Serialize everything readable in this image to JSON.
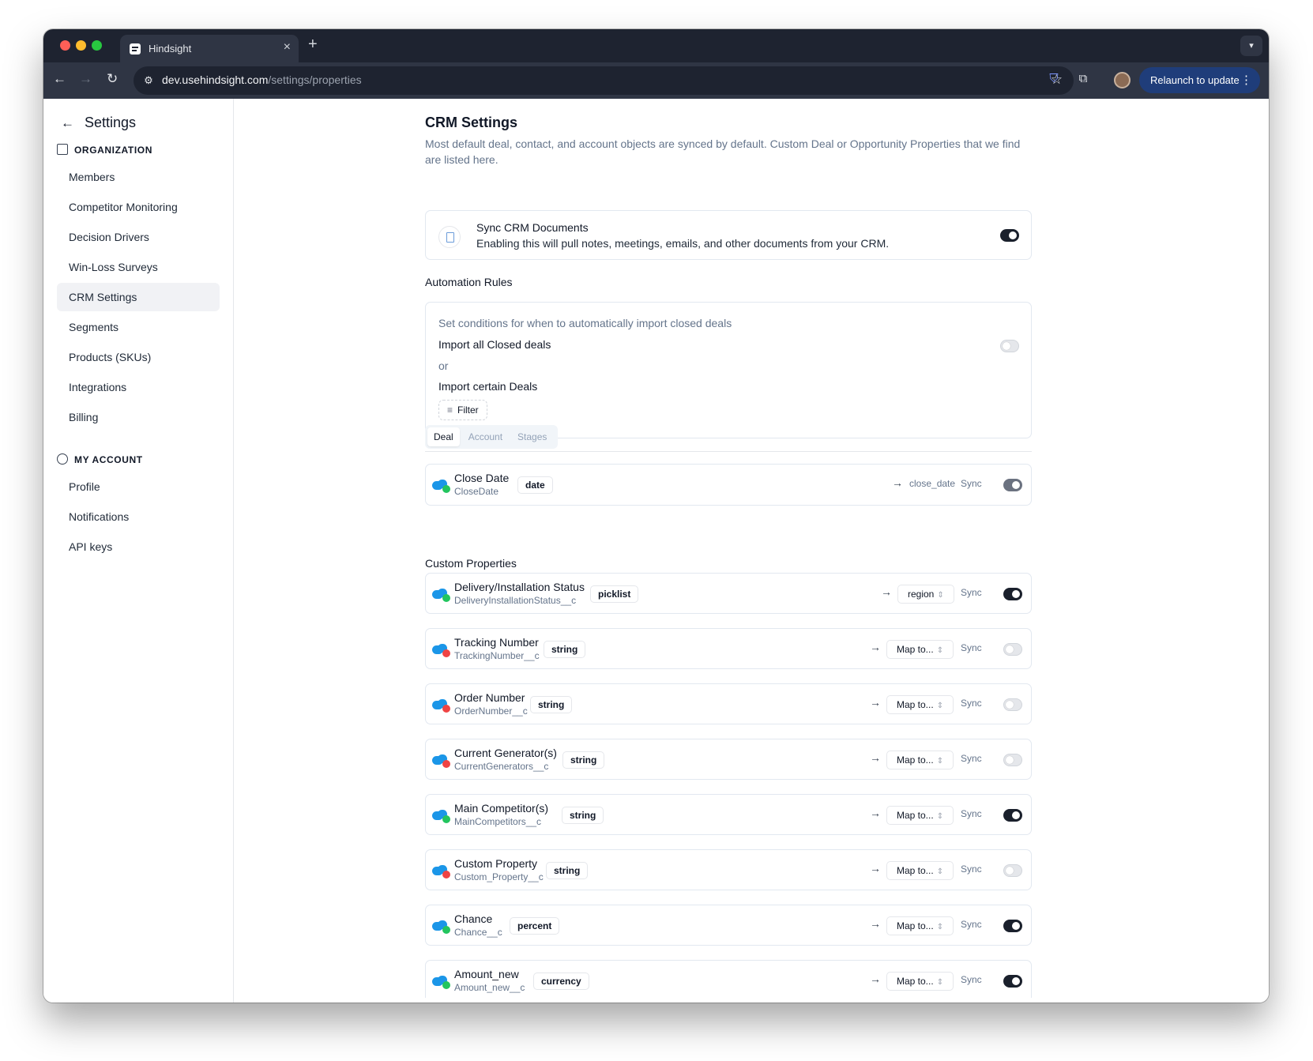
{
  "browser": {
    "tab_title": "Hindsight",
    "url_host": "dev.usehindsight.com",
    "url_path": "/settings/properties",
    "relaunch_label": "Relaunch to update"
  },
  "sidebar": {
    "title": "Settings",
    "org_section": "ORGANIZATION",
    "org_items": [
      "Members",
      "Competitor Monitoring",
      "Decision Drivers",
      "Win-Loss Surveys",
      "CRM Settings",
      "Segments",
      "Products (SKUs)",
      "Integrations",
      "Billing"
    ],
    "account_section": "MY ACCOUNT",
    "account_items": [
      "Profile",
      "Notifications",
      "API keys"
    ]
  },
  "page": {
    "title": "CRM Settings",
    "description": "Most default deal, contact, and account objects are synced by default. Custom Deal or Opportunity Properties that we find are listed here.",
    "sync_card": {
      "title": "Sync CRM Documents",
      "description": "Enabling this will pull notes, meetings, emails, and other documents from your CRM.",
      "enabled": true
    },
    "automation": {
      "heading": "Automation Rules",
      "subtitle": "Set conditions for when to automatically import closed deals",
      "import_all_label": "Import all Closed deals",
      "import_all_enabled": false,
      "or_label": "or",
      "import_certain_label": "Import certain Deals",
      "filter_label": "Filter"
    },
    "tabs": [
      "Deal",
      "Account",
      "Stages"
    ],
    "active_tab": "Deal",
    "sync_label": "Sync",
    "standard_property": {
      "name": "Close Date",
      "api": "CloseDate",
      "type": "date",
      "mapped_to": "close_date",
      "sync": true
    },
    "custom_heading": "Custom Properties",
    "custom_properties": [
      {
        "name": "Delivery/Installation Status",
        "api": "DeliveryInstallationStatus__c",
        "type": "picklist",
        "map": "region",
        "sync": true,
        "status": "green"
      },
      {
        "name": "Tracking Number",
        "api": "TrackingNumber__c",
        "type": "string",
        "map": "Map to...",
        "sync": false,
        "status": "red"
      },
      {
        "name": "Order Number",
        "api": "OrderNumber__c",
        "type": "string",
        "map": "Map to...",
        "sync": false,
        "status": "red"
      },
      {
        "name": "Current Generator(s)",
        "api": "CurrentGenerators__c",
        "type": "string",
        "map": "Map to...",
        "sync": false,
        "status": "red"
      },
      {
        "name": "Main Competitor(s)",
        "api": "MainCompetitors__c",
        "type": "string",
        "map": "Map to...",
        "sync": true,
        "status": "green"
      },
      {
        "name": "Custom Property",
        "api": "Custom_Property__c",
        "type": "string",
        "map": "Map to...",
        "sync": false,
        "status": "red"
      },
      {
        "name": "Chance",
        "api": "Chance__c",
        "type": "percent",
        "map": "Map to...",
        "sync": true,
        "status": "green"
      },
      {
        "name": "Amount_new",
        "api": "Amount_new__c",
        "type": "currency",
        "map": "Map to...",
        "sync": true,
        "status": "green"
      }
    ]
  }
}
